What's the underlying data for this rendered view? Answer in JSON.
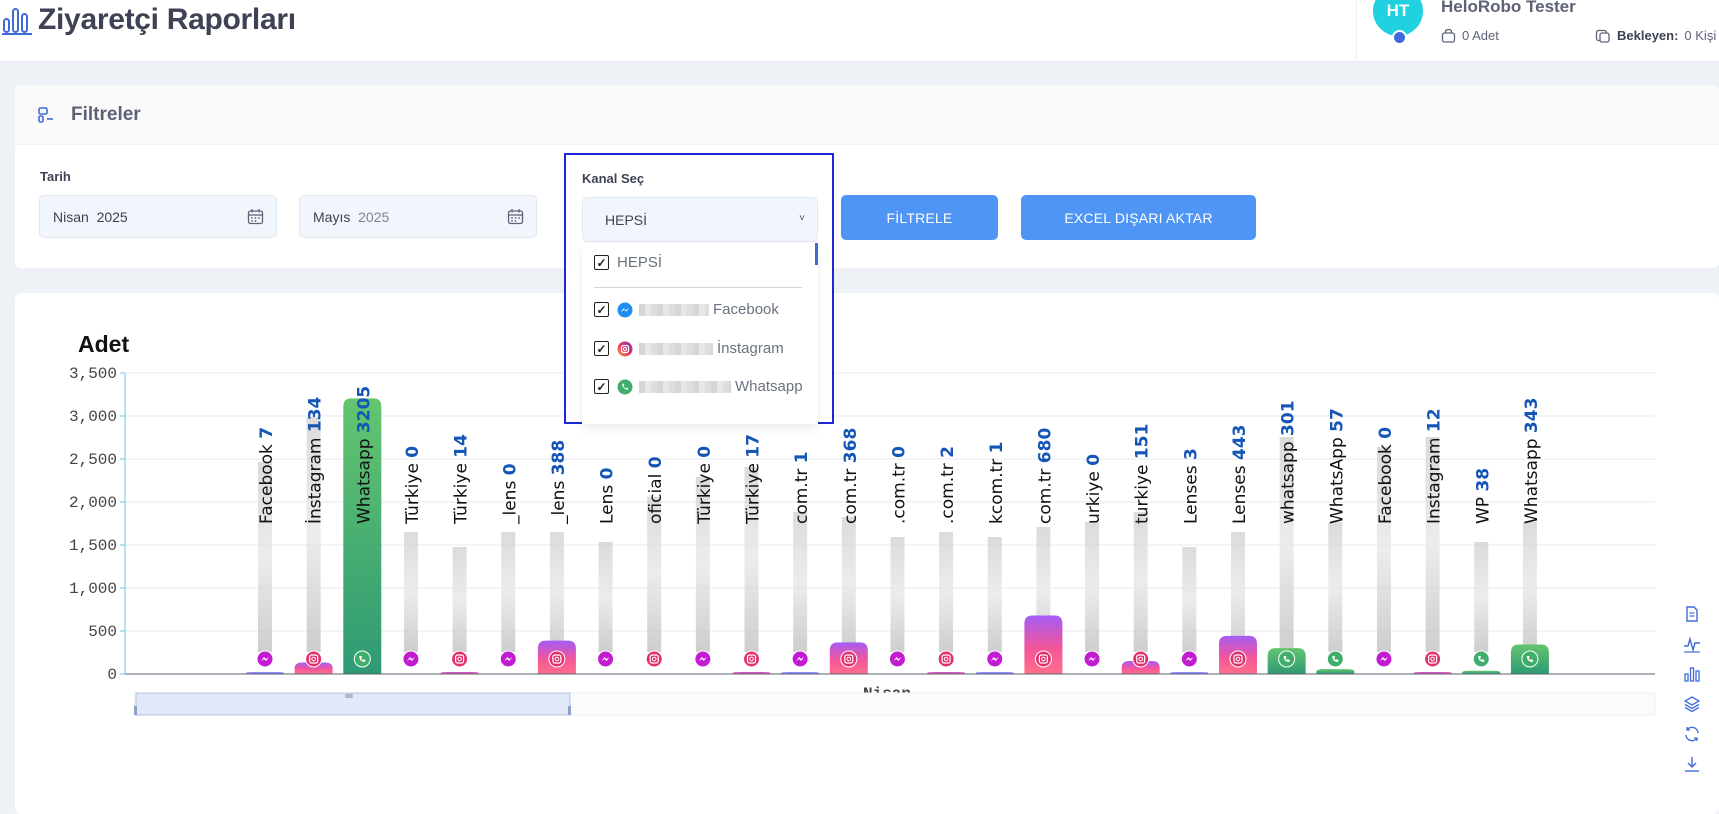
{
  "header": {
    "title": "Ziyaretçi Raporları",
    "user": {
      "initials": "HT",
      "name": "HeloRobo Tester",
      "adet_value": "0 Adet",
      "bekleyen_label": "Bekleyen:",
      "bekleyen_value": "0 Kişi"
    }
  },
  "filters": {
    "title": "Filtreler",
    "date_label": "Tarih",
    "start_month": "Nisan",
    "start_year": "2025",
    "end_month": "Mayıs",
    "end_year": "2025",
    "channel_label": "Kanal Seç",
    "channel_selected": "HEPSİ",
    "channel_options": [
      {
        "label": "HEPSİ",
        "checked": true,
        "icon": "none"
      },
      {
        "label": "Facebook",
        "checked": true,
        "icon": "messenger-icon"
      },
      {
        "label": "İnstagram",
        "checked": true,
        "icon": "instagram-icon"
      },
      {
        "label": "Whatsapp",
        "checked": true,
        "icon": "whatsapp-icon"
      }
    ],
    "filter_button": "FİLTRELE",
    "excel_button": "EXCEL DIŞARI AKTAR"
  },
  "colors": {
    "accent": "#4f95f5",
    "facebook": "#5b7cf7",
    "instagram": "#f04fa0",
    "whatsapp": "#3fae6b",
    "label_blue": "#1455b5",
    "highlight_border": "#1c28d6"
  },
  "chart_data": {
    "type": "bar",
    "title": "Adet",
    "xlabel": "Nisan",
    "ylim": [
      0,
      3500
    ],
    "yticks": [
      "0",
      "500",
      "1,000",
      "1,500",
      "2,000",
      "2,500",
      "3,000",
      "3,500"
    ],
    "grid": true,
    "categories": [
      "Facebook",
      "İnstagram",
      "Whatsapp",
      "Türkiye",
      "Türkiye",
      "_lens",
      "_lens",
      "Lens",
      "oficial",
      "Türkiye",
      "Türkiye",
      "com.tr",
      "com.tr",
      ".com.tr",
      ".com.tr",
      "kcom.tr",
      "com.tr",
      "urkiye",
      "turkiye",
      "Lenses",
      "Lenses",
      "whatsapp",
      "WhatsApp",
      "Facebook",
      "Instagram",
      "WP",
      "Whatsapp"
    ],
    "channels": [
      "facebook",
      "instagram",
      "whatsapp",
      "facebook",
      "instagram",
      "facebook",
      "instagram",
      "facebook",
      "instagram",
      "facebook",
      "instagram",
      "facebook",
      "instagram",
      "facebook",
      "instagram",
      "facebook",
      "instagram",
      "facebook",
      "instagram",
      "facebook",
      "instagram",
      "whatsapp",
      "whatsapp",
      "facebook",
      "instagram",
      "whatsapp",
      "whatsapp"
    ],
    "values": [
      7,
      134,
      3205,
      0,
      14,
      0,
      388,
      0,
      0,
      0,
      17,
      1,
      368,
      0,
      2,
      1,
      680,
      0,
      151,
      3,
      443,
      301,
      57,
      0,
      12,
      38,
      343
    ]
  }
}
